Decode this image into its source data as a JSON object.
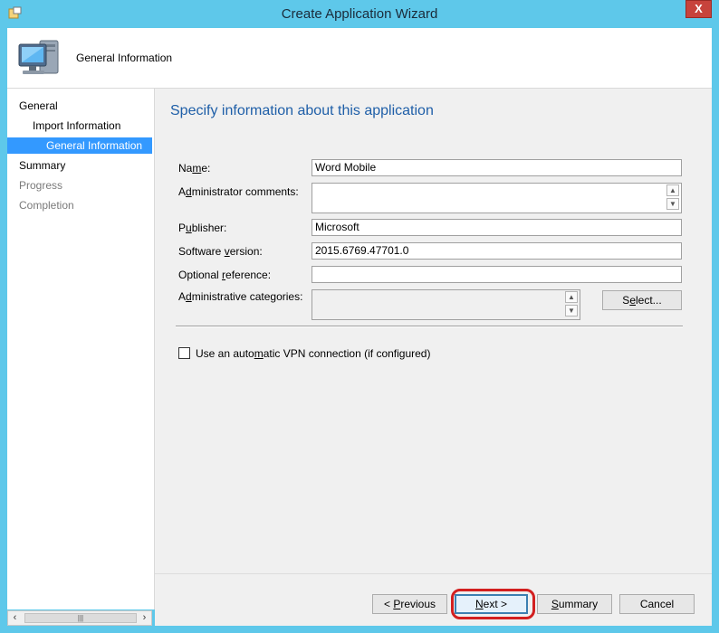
{
  "window": {
    "title": "Create Application Wizard",
    "close_label": "X"
  },
  "header": {
    "title": "General Information"
  },
  "nav": {
    "items": [
      {
        "label": "General",
        "state": "normal"
      },
      {
        "label": "Import Information",
        "state": "normal"
      },
      {
        "label": "General Information",
        "state": "selected"
      },
      {
        "label": "Summary",
        "state": "normal"
      },
      {
        "label": "Progress",
        "state": "disabled"
      },
      {
        "label": "Completion",
        "state": "disabled"
      }
    ]
  },
  "main": {
    "heading": "Specify information about this application",
    "fields": {
      "name": {
        "label_pre": "Na",
        "label_u": "m",
        "label_post": "e:",
        "value": "Word Mobile"
      },
      "admin_comments": {
        "label_pre": "A",
        "label_u": "d",
        "label_post": "ministrator comments:",
        "value": ""
      },
      "publisher": {
        "label_pre": "P",
        "label_u": "u",
        "label_post": "blisher:",
        "value": "Microsoft"
      },
      "software_version": {
        "label_pre": "Software ",
        "label_u": "v",
        "label_post": "ersion:",
        "value": "2015.6769.47701.0"
      },
      "optional_reference": {
        "label_pre": "Optional ",
        "label_u": "r",
        "label_post": "eference:",
        "value": ""
      },
      "admin_categories": {
        "label_pre": "A",
        "label_u": "d",
        "label_post": "ministrative categories:",
        "value": ""
      }
    },
    "select_button": {
      "pre": "S",
      "u": "e",
      "post": "lect..."
    },
    "vpn_checkbox": {
      "pre": "Use an auto",
      "u": "m",
      "post": "atic VPN connection (if configured)",
      "checked": false
    }
  },
  "footer": {
    "previous": {
      "pre": "< ",
      "u": "P",
      "post": "revious"
    },
    "next": {
      "pre": "",
      "u": "N",
      "post": "ext >"
    },
    "summary": {
      "pre": "",
      "u": "S",
      "post": "ummary"
    },
    "cancel": {
      "label": "Cancel"
    }
  },
  "colors": {
    "accent": "#3399ff",
    "heading": "#1f5fa8",
    "highlight": "#d21f1f",
    "frame": "#5ec8ea"
  }
}
